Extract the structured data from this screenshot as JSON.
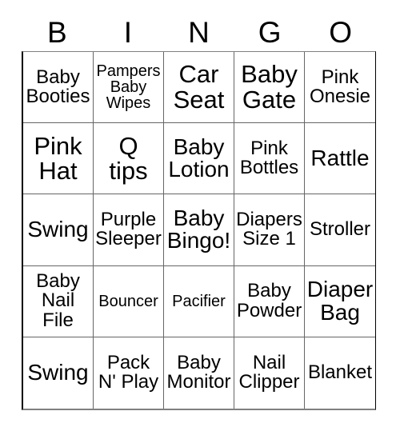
{
  "header": {
    "letters": [
      "B",
      "I",
      "N",
      "G",
      "O"
    ]
  },
  "grid": {
    "rows": 5,
    "columns": 5,
    "border_color": "#000000",
    "background_color": "#ffffff",
    "text_color": "#000000",
    "cells": [
      {
        "text": "Baby\nBooties",
        "size": "md"
      },
      {
        "text": "Pampers\nBaby\nWipes",
        "size": "sm"
      },
      {
        "text": "Car\nSeat",
        "size": "xl"
      },
      {
        "text": "Baby\nGate",
        "size": "xl"
      },
      {
        "text": "Pink\nOnesie",
        "size": "md"
      },
      {
        "text": "Pink\nHat",
        "size": "xl"
      },
      {
        "text": "Q\ntips",
        "size": "xl"
      },
      {
        "text": "Baby\nLotion",
        "size": "lg"
      },
      {
        "text": "Pink\nBottles",
        "size": "md"
      },
      {
        "text": "Rattle",
        "size": "lg"
      },
      {
        "text": "Swing",
        "size": "lg"
      },
      {
        "text": "Purple\nSleeper",
        "size": "md"
      },
      {
        "text": "Baby\nBingo!",
        "size": "lg"
      },
      {
        "text": "Diapers\nSize 1",
        "size": "md"
      },
      {
        "text": "Stroller",
        "size": "md"
      },
      {
        "text": "Baby\nNail\nFile",
        "size": "md"
      },
      {
        "text": "Bouncer",
        "size": "sm"
      },
      {
        "text": "Pacifier",
        "size": "sm"
      },
      {
        "text": "Baby\nPowder",
        "size": "md"
      },
      {
        "text": "Diaper\nBag",
        "size": "lg"
      },
      {
        "text": "Swing",
        "size": "lg"
      },
      {
        "text": "Pack\nN' Play",
        "size": "md"
      },
      {
        "text": "Baby\nMonitor",
        "size": "md"
      },
      {
        "text": "Nail\nClipper",
        "size": "md"
      },
      {
        "text": "Blanket",
        "size": "md"
      }
    ]
  }
}
